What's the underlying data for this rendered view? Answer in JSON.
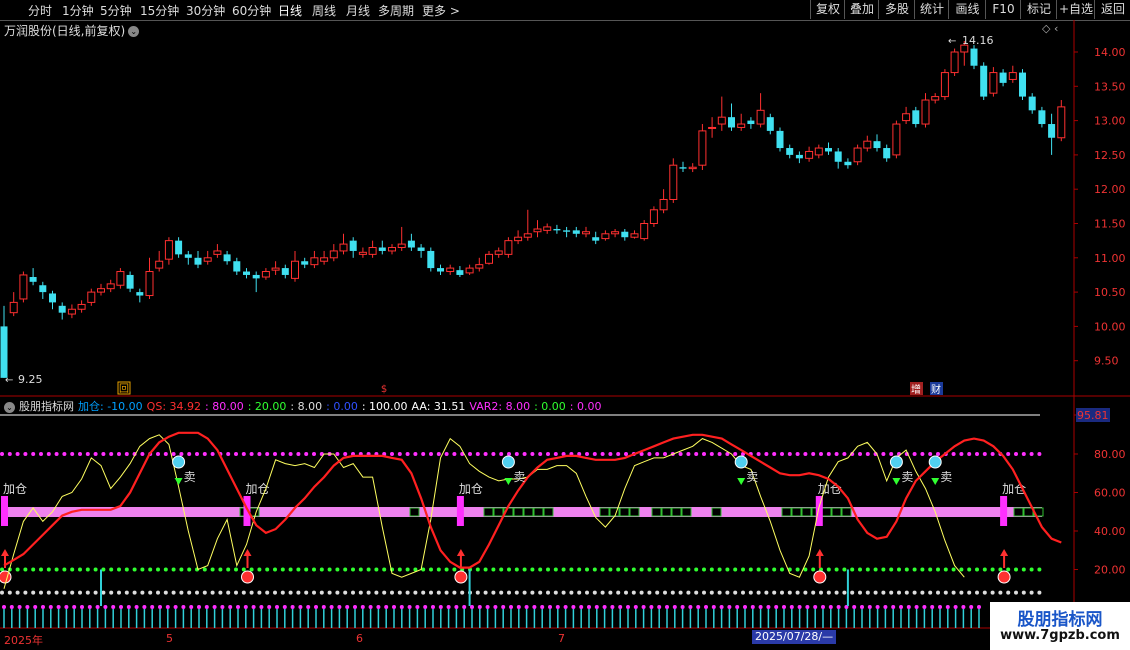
{
  "toolbar": {
    "periods": [
      "分时",
      "1分钟",
      "5分钟",
      "15分钟",
      "30分钟",
      "60分钟",
      "日线",
      "周线",
      "月线",
      "多周期",
      "更多 >"
    ],
    "active_period": "日线",
    "right_buttons": [
      "复权",
      "叠加",
      "多股",
      "统计",
      "画线",
      "F10",
      "标记",
      "+自选",
      "返回"
    ]
  },
  "main": {
    "title": "万润股份(日线,前复权)",
    "high_label": "14.16",
    "low_label": "9.25",
    "markers": {
      "hui": "回",
      "zeng": "增",
      "cai": "财"
    },
    "price_axis": [
      "14.00",
      "13.50",
      "13.00",
      "12.50",
      "12.00",
      "11.50",
      "11.00",
      "10.50",
      "10.00",
      "9.50"
    ]
  },
  "indicator": {
    "name": "股朋指标网",
    "values": [
      {
        "text": "加仓: -10.00",
        "color": "#00a0ff"
      },
      {
        "text": "QS: 34.92",
        "color": "#ff3030"
      },
      {
        "text": ": 80.00",
        "color": "#ff30ff"
      },
      {
        "text": ": 20.00",
        "color": "#30ff30"
      },
      {
        "text": ": 8.00",
        "color": "#dddddd"
      },
      {
        "text": ": 0.00",
        "color": "#3050ff"
      },
      {
        "text": ": 100.00",
        "color": "#ffffff"
      },
      {
        "text": "AA: 31.51",
        "color": "#ffffff"
      },
      {
        "text": "VAR2: 8.00",
        "color": "#ff30ff"
      },
      {
        "text": ": 0.00",
        "color": "#30ff30"
      },
      {
        "text": ": 0.00",
        "color": "#ff30ff"
      }
    ],
    "axis": [
      "95.81",
      "80.00",
      "60.00",
      "40.00",
      "20.00"
    ],
    "add_label": "加仓",
    "sell_label": "卖"
  },
  "date_axis": {
    "labels": [
      "2025年",
      "5",
      "6",
      "7"
    ],
    "cursor_date": "2025/07/28/—"
  },
  "watermark": {
    "title": "股朋指标网",
    "url": "www.7gpzb.com"
  },
  "colors": {
    "up": "#ff3030",
    "down": "#40e0f0",
    "bar": "#ee82ee",
    "qs": "#ff2020",
    "aa": "#ffff60"
  },
  "candles": [
    [
      10.0,
      9.25,
      10.3,
      9.25
    ],
    [
      10.2,
      10.35,
      10.5,
      10.15
    ],
    [
      10.4,
      10.75,
      10.8,
      10.35
    ],
    [
      10.72,
      10.65,
      10.85,
      10.6
    ],
    [
      10.6,
      10.5,
      10.65,
      10.4
    ],
    [
      10.48,
      10.35,
      10.52,
      10.25
    ],
    [
      10.3,
      10.2,
      10.35,
      10.1
    ],
    [
      10.18,
      10.25,
      10.32,
      10.12
    ],
    [
      10.25,
      10.32,
      10.38,
      10.2
    ],
    [
      10.35,
      10.5,
      10.55,
      10.3
    ],
    [
      10.5,
      10.55,
      10.62,
      10.45
    ],
    [
      10.55,
      10.62,
      10.68,
      10.5
    ],
    [
      10.6,
      10.8,
      10.85,
      10.55
    ],
    [
      10.75,
      10.55,
      10.8,
      10.5
    ],
    [
      10.5,
      10.45,
      10.55,
      10.35
    ],
    [
      10.45,
      10.8,
      11.0,
      10.4
    ],
    [
      10.85,
      10.95,
      11.1,
      10.8
    ],
    [
      10.98,
      11.25,
      11.3,
      10.9
    ],
    [
      11.25,
      11.05,
      11.3,
      11.0
    ],
    [
      11.05,
      11.0,
      11.1,
      10.9
    ],
    [
      11.0,
      10.9,
      11.1,
      10.85
    ],
    [
      10.95,
      11.0,
      11.1,
      10.9
    ],
    [
      11.05,
      11.1,
      11.2,
      11.0
    ],
    [
      11.05,
      10.95,
      11.1,
      10.9
    ],
    [
      10.95,
      10.8,
      11.0,
      10.75
    ],
    [
      10.8,
      10.75,
      10.85,
      10.7
    ],
    [
      10.75,
      10.7,
      10.8,
      10.5
    ],
    [
      10.72,
      10.8,
      10.85,
      10.68
    ],
    [
      10.82,
      10.85,
      10.95,
      10.75
    ],
    [
      10.85,
      10.75,
      10.9,
      10.7
    ],
    [
      10.7,
      10.95,
      11.1,
      10.65
    ],
    [
      10.95,
      10.9,
      11.0,
      10.85
    ],
    [
      10.9,
      11.0,
      11.1,
      10.85
    ],
    [
      10.95,
      11.0,
      11.1,
      10.9
    ],
    [
      11.0,
      11.1,
      11.2,
      10.95
    ],
    [
      11.1,
      11.2,
      11.35,
      11.05
    ],
    [
      11.25,
      11.1,
      11.3,
      11.0
    ],
    [
      11.05,
      11.08,
      11.15,
      11.0
    ],
    [
      11.05,
      11.15,
      11.25,
      11.0
    ],
    [
      11.15,
      11.1,
      11.25,
      11.05
    ],
    [
      11.1,
      11.15,
      11.2,
      11.05
    ],
    [
      11.15,
      11.2,
      11.45,
      11.1
    ],
    [
      11.25,
      11.15,
      11.35,
      11.1
    ],
    [
      11.15,
      11.1,
      11.2,
      11.0
    ],
    [
      11.1,
      10.85,
      11.15,
      10.8
    ],
    [
      10.85,
      10.8,
      10.9,
      10.75
    ],
    [
      10.8,
      10.85,
      10.9,
      10.75
    ],
    [
      10.82,
      10.75,
      10.88,
      10.72
    ],
    [
      10.78,
      10.85,
      10.9,
      10.75
    ],
    [
      10.85,
      10.9,
      11.0,
      10.8
    ],
    [
      10.92,
      11.05,
      11.1,
      10.9
    ],
    [
      11.05,
      11.1,
      11.15,
      11.0
    ],
    [
      11.05,
      11.25,
      11.3,
      11.0
    ],
    [
      11.25,
      11.3,
      11.4,
      11.2
    ],
    [
      11.3,
      11.35,
      11.7,
      11.25
    ],
    [
      11.38,
      11.42,
      11.55,
      11.3
    ],
    [
      11.4,
      11.45,
      11.5,
      11.35
    ],
    [
      11.42,
      11.4,
      11.48,
      11.35
    ],
    [
      11.4,
      11.38,
      11.45,
      11.3
    ],
    [
      11.4,
      11.35,
      11.45,
      11.3
    ],
    [
      11.35,
      11.38,
      11.45,
      11.3
    ],
    [
      11.3,
      11.25,
      11.38,
      11.2
    ],
    [
      11.28,
      11.35,
      11.4,
      11.25
    ],
    [
      11.35,
      11.38,
      11.42,
      11.3
    ],
    [
      11.38,
      11.3,
      11.42,
      11.25
    ],
    [
      11.3,
      11.35,
      11.4,
      11.28
    ],
    [
      11.28,
      11.5,
      11.55,
      11.25
    ],
    [
      11.5,
      11.7,
      11.75,
      11.45
    ],
    [
      11.7,
      11.85,
      12.0,
      11.65
    ],
    [
      11.85,
      12.35,
      12.45,
      11.8
    ],
    [
      12.32,
      12.3,
      12.4,
      12.25
    ],
    [
      12.3,
      12.32,
      12.38,
      12.25
    ],
    [
      12.35,
      12.85,
      12.95,
      12.28
    ],
    [
      12.9,
      12.9,
      13.05,
      12.75
    ],
    [
      12.95,
      13.05,
      13.35,
      12.85
    ],
    [
      13.05,
      12.9,
      13.25,
      12.85
    ],
    [
      12.9,
      12.95,
      13.1,
      12.85
    ],
    [
      13.0,
      12.95,
      13.05,
      12.88
    ],
    [
      12.95,
      13.15,
      13.4,
      12.9
    ],
    [
      13.05,
      12.85,
      13.1,
      12.8
    ],
    [
      12.85,
      12.6,
      12.9,
      12.55
    ],
    [
      12.6,
      12.5,
      12.65,
      12.45
    ],
    [
      12.5,
      12.45,
      12.55,
      12.38
    ],
    [
      12.45,
      12.55,
      12.62,
      12.4
    ],
    [
      12.5,
      12.6,
      12.65,
      12.45
    ],
    [
      12.6,
      12.55,
      12.68,
      12.5
    ],
    [
      12.55,
      12.4,
      12.6,
      12.3
    ],
    [
      12.4,
      12.35,
      12.45,
      12.3
    ],
    [
      12.4,
      12.6,
      12.65,
      12.35
    ],
    [
      12.6,
      12.7,
      12.78,
      12.55
    ],
    [
      12.7,
      12.6,
      12.8,
      12.55
    ],
    [
      12.6,
      12.45,
      12.65,
      12.4
    ],
    [
      12.5,
      12.95,
      13.0,
      12.45
    ],
    [
      13.0,
      13.1,
      13.2,
      12.95
    ],
    [
      13.15,
      12.95,
      13.2,
      12.9
    ],
    [
      12.95,
      13.3,
      13.4,
      12.9
    ],
    [
      13.3,
      13.35,
      13.4,
      13.25
    ],
    [
      13.35,
      13.7,
      13.75,
      13.3
    ],
    [
      13.7,
      14.0,
      14.05,
      13.65
    ],
    [
      14.0,
      14.1,
      14.16,
      13.8
    ],
    [
      14.05,
      13.8,
      14.1,
      13.75
    ],
    [
      13.8,
      13.35,
      13.85,
      13.3
    ],
    [
      13.4,
      13.7,
      13.78,
      13.35
    ],
    [
      13.7,
      13.55,
      13.75,
      13.5
    ],
    [
      13.6,
      13.7,
      13.8,
      13.55
    ],
    [
      13.7,
      13.35,
      13.75,
      13.3
    ],
    [
      13.35,
      13.15,
      13.4,
      13.1
    ],
    [
      13.15,
      12.95,
      13.2,
      12.9
    ],
    [
      12.95,
      12.75,
      13.1,
      12.5
    ],
    [
      12.75,
      13.2,
      13.3,
      12.7
    ]
  ],
  "sub_series": {
    "qs": [
      22,
      25,
      28,
      33,
      38,
      43,
      48,
      50,
      51,
      51,
      51,
      51,
      53,
      60,
      70,
      80,
      86,
      89,
      91,
      91,
      91,
      88,
      82,
      72,
      62,
      52,
      43,
      39,
      41,
      46,
      52,
      57,
      63,
      68,
      74,
      78,
      79,
      79,
      79,
      79,
      78,
      77,
      70,
      57,
      42,
      30,
      24,
      21,
      21,
      24,
      33,
      43,
      53,
      61,
      68,
      73,
      77,
      78,
      79,
      79,
      78,
      77,
      77,
      77,
      78,
      80,
      82,
      84,
      86,
      88,
      89,
      90,
      90,
      89,
      88,
      85,
      82,
      79,
      76,
      73,
      70,
      69,
      69,
      70,
      69,
      67,
      63,
      57,
      46,
      39,
      36,
      37,
      45,
      57,
      66,
      71,
      76,
      80,
      84,
      87,
      88,
      87,
      84,
      79,
      72,
      62,
      52,
      42,
      36,
      34
    ],
    "aa": [
      10,
      28,
      45,
      52,
      45,
      50,
      58,
      60,
      67,
      78,
      74,
      62,
      68,
      75,
      84,
      88,
      90,
      85,
      63,
      40,
      20,
      22,
      36,
      46,
      22,
      33,
      50,
      62,
      77,
      75,
      74,
      75,
      73,
      80,
      80,
      73,
      75,
      68,
      68,
      42,
      18,
      16,
      18,
      20,
      46,
      78,
      88,
      84,
      75,
      71,
      68,
      66,
      67,
      67,
      68,
      72,
      72,
      74,
      74,
      70,
      58,
      47,
      42,
      48,
      62,
      74,
      76,
      78,
      78,
      80,
      82,
      84,
      88,
      86,
      83,
      80,
      74,
      72,
      58,
      45,
      30,
      18,
      16,
      27,
      52,
      68,
      76,
      78,
      84,
      86,
      80,
      66,
      78,
      82,
      71,
      62,
      50,
      35,
      22,
      16
    ]
  },
  "add_positions": [
    0,
    25,
    47,
    84,
    103
  ],
  "sell_positions": [
    18,
    52,
    76,
    92,
    96
  ],
  "cyan_spikes": [
    10,
    48,
    87
  ]
}
